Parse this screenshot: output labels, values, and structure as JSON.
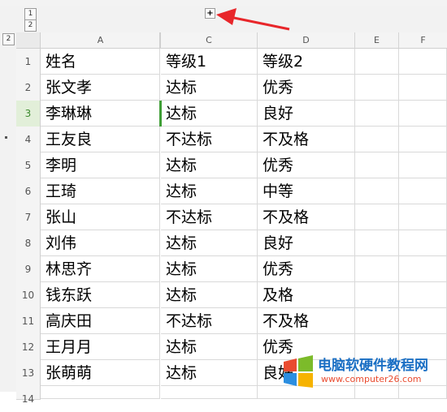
{
  "outline": {
    "level_buttons_top": [
      "1",
      "2"
    ],
    "level_buttons_left": [
      "2"
    ],
    "expand_symbol": "+"
  },
  "columns": [
    "A",
    "C",
    "D",
    "E",
    "F"
  ],
  "rows": [
    {
      "num": "1",
      "name": "姓名",
      "grade1": "等级1",
      "grade2": "等级2"
    },
    {
      "num": "2",
      "name": "张文孝",
      "grade1": "达标",
      "grade2": "优秀"
    },
    {
      "num": "3",
      "name": "李琳琳",
      "grade1": "达标",
      "grade2": "良好"
    },
    {
      "num": "4",
      "name": "王友良",
      "grade1": "不达标",
      "grade2": "不及格"
    },
    {
      "num": "5",
      "name": "李明",
      "grade1": "达标",
      "grade2": "优秀"
    },
    {
      "num": "6",
      "name": "王琦",
      "grade1": "达标",
      "grade2": "中等"
    },
    {
      "num": "7",
      "name": "张山",
      "grade1": "不达标",
      "grade2": "不及格"
    },
    {
      "num": "8",
      "name": "刘伟",
      "grade1": "达标",
      "grade2": "良好"
    },
    {
      "num": "9",
      "name": "林思齐",
      "grade1": "达标",
      "grade2": "优秀"
    },
    {
      "num": "10",
      "name": "钱东跃",
      "grade1": "达标",
      "grade2": "及格"
    },
    {
      "num": "11",
      "name": "高庆田",
      "grade1": "不达标",
      "grade2": "不及格"
    },
    {
      "num": "12",
      "name": "王月月",
      "grade1": "达标",
      "grade2": "优秀"
    },
    {
      "num": "13",
      "name": "张萌萌",
      "grade1": "达标",
      "grade2": "良好"
    },
    {
      "num": "14",
      "name": "",
      "grade1": "",
      "grade2": ""
    }
  ],
  "selected_row": "3",
  "watermark": {
    "title": "电脑软硬件教程网",
    "url": "www.computer26.com"
  },
  "colors": {
    "annotation_arrow": "#e8262a",
    "selection": "#3f9e36",
    "watermark_text": "#1a6fc4"
  }
}
